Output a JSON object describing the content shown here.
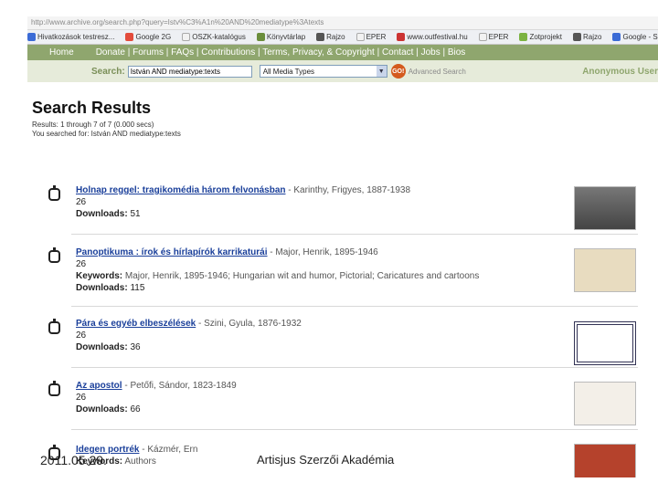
{
  "browser": {
    "url": "http://www.archive.org/search.php?query=Istv%C3%A1n%20AND%20mediatype%3Atexts",
    "bookmarks": [
      "Hivatkozások testresz...",
      "Google 2G",
      "OSZK-katalógus",
      "Könyvtárlap",
      "Rajzo",
      "EPER",
      "www.outfestival.hu",
      "EPER",
      "Zotprojekt",
      "Rajzo",
      "Google - S"
    ]
  },
  "nav": {
    "home": "Home",
    "links": "Donate | Forums | FAQs | Contributions | Terms, Privacy, & Copyright | Contact | Jobs | Bios"
  },
  "search": {
    "label": "Search:",
    "value": "István AND mediatype:texts",
    "media_type": "All Media Types",
    "go": "GO!",
    "advanced": "Advanced Search",
    "user": "Anonymous User"
  },
  "results": {
    "title": "Search Results",
    "summary": "Results: 1 through 7 of 7 (0.000 secs)",
    "searched_for": "You searched for: István AND mediatype:texts",
    "items": [
      {
        "title": "Holnap reggel: tragikomédia három felvonásban",
        "author": " - Karinthy, Frigyes, 1887-1938",
        "num": "26",
        "keywords": "",
        "downloads_label": "Downloads:",
        "downloads": "51"
      },
      {
        "title": "Panoptikuma : írok és hírlapírók karrikaturái",
        "author": " - Major, Henrik, 1895-1946",
        "num": "26",
        "keywords_label": "Keywords:",
        "keywords": "Major, Henrik, 1895-1946; Hungarian wit and humor, Pictorial; Caricatures and cartoons",
        "downloads_label": "Downloads:",
        "downloads": "115"
      },
      {
        "title": "Pára és egyéb elbeszélések",
        "author": " - Szini, Gyula, 1876-1932",
        "num": "26",
        "keywords": "",
        "downloads_label": "Downloads:",
        "downloads": "36"
      },
      {
        "title": "Az apostol",
        "author": " - Petőfi, Sándor, 1823-1849",
        "num": "26",
        "keywords": "",
        "downloads_label": "Downloads:",
        "downloads": "66"
      },
      {
        "title": "Idegen portrék",
        "author": " - Kázmér, Ern",
        "num": "",
        "keywords_label": "Keywords:",
        "keywords": "Authors",
        "downloads_label": "",
        "downloads": ""
      }
    ]
  },
  "footer": {
    "date": "2011.05.29.",
    "org": "Artisjus Szerzői Akadémia"
  },
  "colors": {
    "nav": "#8fa66e",
    "search_row": "#e6ebda",
    "link": "#1a3f9a"
  }
}
